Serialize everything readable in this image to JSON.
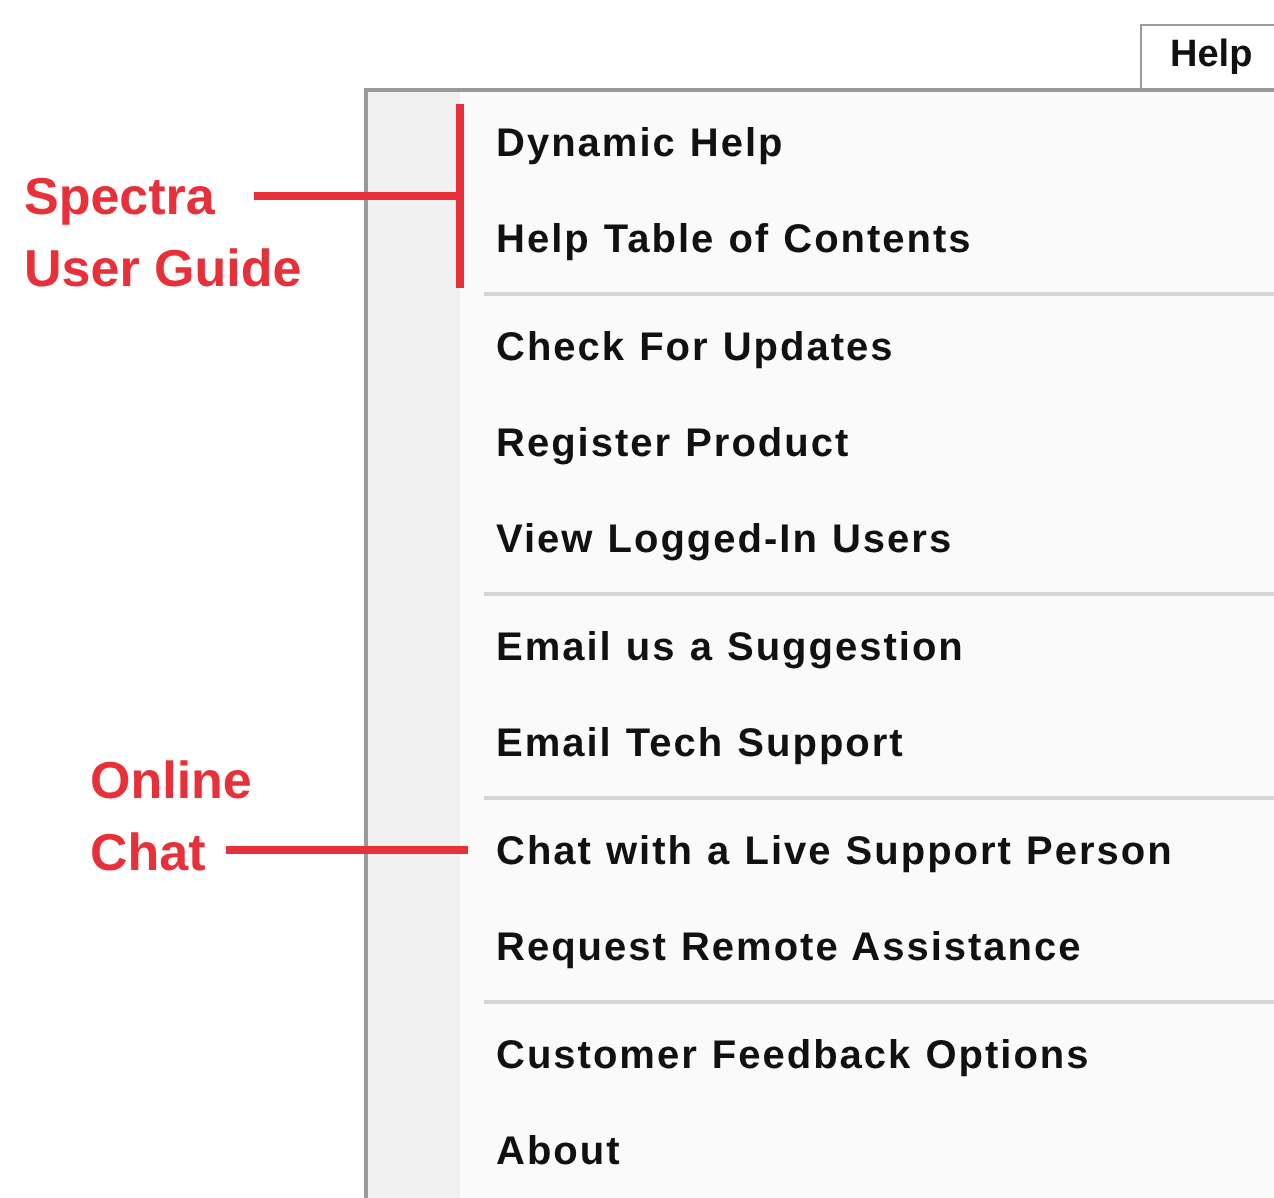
{
  "menu_bar": {
    "tab": {
      "label": "Help",
      "selected": true
    }
  },
  "menu": {
    "groups": [
      {
        "items": [
          {
            "label": "Dynamic Help"
          },
          {
            "label": "Help Table of Contents"
          }
        ]
      },
      {
        "items": [
          {
            "label": "Check For Updates"
          },
          {
            "label": "Register Product"
          },
          {
            "label": "View Logged-In Users"
          }
        ]
      },
      {
        "items": [
          {
            "label": "Email us a Suggestion"
          },
          {
            "label": "Email Tech Support"
          }
        ]
      },
      {
        "items": [
          {
            "label": "Chat with a Live Support Person"
          },
          {
            "label": "Request Remote Assistance"
          }
        ]
      },
      {
        "items": [
          {
            "label": "Customer Feedback Options"
          },
          {
            "label": "About"
          }
        ]
      }
    ]
  },
  "annotations": [
    {
      "kind": "bracket",
      "lines": [
        "Spectra",
        "User Guide"
      ]
    },
    {
      "kind": "line",
      "lines": [
        "Online",
        "Chat"
      ]
    }
  ]
}
